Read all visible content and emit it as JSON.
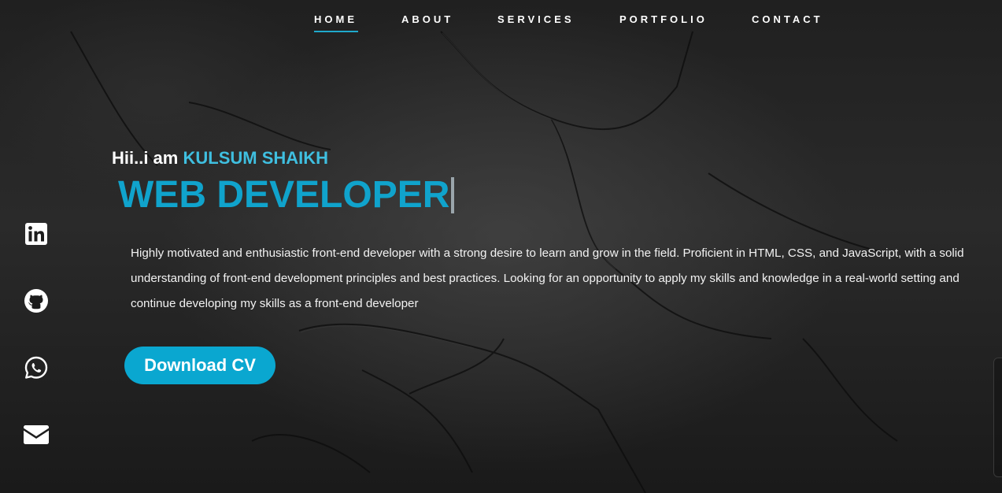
{
  "nav": {
    "items": [
      {
        "label": "HOME",
        "active": true
      },
      {
        "label": "ABOUT",
        "active": false
      },
      {
        "label": "SERVICES",
        "active": false
      },
      {
        "label": "PORTFOLIO",
        "active": false
      },
      {
        "label": "CONTACT",
        "active": false
      }
    ]
  },
  "hero": {
    "greeting_prefix": "Hii..i am ",
    "name": "KULSUM SHAIKH",
    "role": "WEB DEVELOPER",
    "bio": "Highly motivated and enthusiastic front-end developer with a strong desire to learn and grow in the field. Proficient in HTML, CSS, and JavaScript, with a solid understanding of front-end development principles and best practices. Looking for an opportunity to apply my skills and knowledge in a real-world setting and continue developing my skills as a front-end developer",
    "cta_label": "Download CV"
  },
  "social": [
    {
      "icon": "linkedin-icon"
    },
    {
      "icon": "github-icon"
    },
    {
      "icon": "whatsapp-icon"
    },
    {
      "icon": "mail-icon"
    }
  ],
  "colors": {
    "accent": "#10a3cc",
    "name": "#3fbfe0",
    "button": "#0aa7d0",
    "text": "#ffffff",
    "background": "#1b1b1b"
  }
}
